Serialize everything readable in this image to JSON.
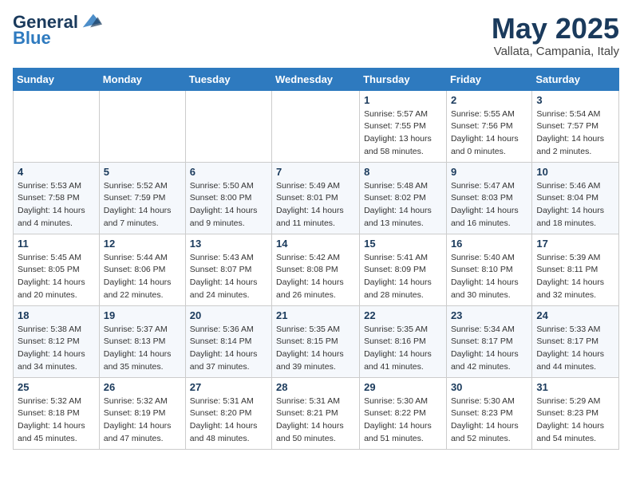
{
  "header": {
    "logo_line1": "General",
    "logo_line2": "Blue",
    "month": "May 2025",
    "location": "Vallata, Campania, Italy"
  },
  "days_of_week": [
    "Sunday",
    "Monday",
    "Tuesday",
    "Wednesday",
    "Thursday",
    "Friday",
    "Saturday"
  ],
  "weeks": [
    [
      {
        "day": "",
        "info": ""
      },
      {
        "day": "",
        "info": ""
      },
      {
        "day": "",
        "info": ""
      },
      {
        "day": "",
        "info": ""
      },
      {
        "day": "1",
        "info": "Sunrise: 5:57 AM\nSunset: 7:55 PM\nDaylight: 13 hours\nand 58 minutes."
      },
      {
        "day": "2",
        "info": "Sunrise: 5:55 AM\nSunset: 7:56 PM\nDaylight: 14 hours\nand 0 minutes."
      },
      {
        "day": "3",
        "info": "Sunrise: 5:54 AM\nSunset: 7:57 PM\nDaylight: 14 hours\nand 2 minutes."
      }
    ],
    [
      {
        "day": "4",
        "info": "Sunrise: 5:53 AM\nSunset: 7:58 PM\nDaylight: 14 hours\nand 4 minutes."
      },
      {
        "day": "5",
        "info": "Sunrise: 5:52 AM\nSunset: 7:59 PM\nDaylight: 14 hours\nand 7 minutes."
      },
      {
        "day": "6",
        "info": "Sunrise: 5:50 AM\nSunset: 8:00 PM\nDaylight: 14 hours\nand 9 minutes."
      },
      {
        "day": "7",
        "info": "Sunrise: 5:49 AM\nSunset: 8:01 PM\nDaylight: 14 hours\nand 11 minutes."
      },
      {
        "day": "8",
        "info": "Sunrise: 5:48 AM\nSunset: 8:02 PM\nDaylight: 14 hours\nand 13 minutes."
      },
      {
        "day": "9",
        "info": "Sunrise: 5:47 AM\nSunset: 8:03 PM\nDaylight: 14 hours\nand 16 minutes."
      },
      {
        "day": "10",
        "info": "Sunrise: 5:46 AM\nSunset: 8:04 PM\nDaylight: 14 hours\nand 18 minutes."
      }
    ],
    [
      {
        "day": "11",
        "info": "Sunrise: 5:45 AM\nSunset: 8:05 PM\nDaylight: 14 hours\nand 20 minutes."
      },
      {
        "day": "12",
        "info": "Sunrise: 5:44 AM\nSunset: 8:06 PM\nDaylight: 14 hours\nand 22 minutes."
      },
      {
        "day": "13",
        "info": "Sunrise: 5:43 AM\nSunset: 8:07 PM\nDaylight: 14 hours\nand 24 minutes."
      },
      {
        "day": "14",
        "info": "Sunrise: 5:42 AM\nSunset: 8:08 PM\nDaylight: 14 hours\nand 26 minutes."
      },
      {
        "day": "15",
        "info": "Sunrise: 5:41 AM\nSunset: 8:09 PM\nDaylight: 14 hours\nand 28 minutes."
      },
      {
        "day": "16",
        "info": "Sunrise: 5:40 AM\nSunset: 8:10 PM\nDaylight: 14 hours\nand 30 minutes."
      },
      {
        "day": "17",
        "info": "Sunrise: 5:39 AM\nSunset: 8:11 PM\nDaylight: 14 hours\nand 32 minutes."
      }
    ],
    [
      {
        "day": "18",
        "info": "Sunrise: 5:38 AM\nSunset: 8:12 PM\nDaylight: 14 hours\nand 34 minutes."
      },
      {
        "day": "19",
        "info": "Sunrise: 5:37 AM\nSunset: 8:13 PM\nDaylight: 14 hours\nand 35 minutes."
      },
      {
        "day": "20",
        "info": "Sunrise: 5:36 AM\nSunset: 8:14 PM\nDaylight: 14 hours\nand 37 minutes."
      },
      {
        "day": "21",
        "info": "Sunrise: 5:35 AM\nSunset: 8:15 PM\nDaylight: 14 hours\nand 39 minutes."
      },
      {
        "day": "22",
        "info": "Sunrise: 5:35 AM\nSunset: 8:16 PM\nDaylight: 14 hours\nand 41 minutes."
      },
      {
        "day": "23",
        "info": "Sunrise: 5:34 AM\nSunset: 8:17 PM\nDaylight: 14 hours\nand 42 minutes."
      },
      {
        "day": "24",
        "info": "Sunrise: 5:33 AM\nSunset: 8:17 PM\nDaylight: 14 hours\nand 44 minutes."
      }
    ],
    [
      {
        "day": "25",
        "info": "Sunrise: 5:32 AM\nSunset: 8:18 PM\nDaylight: 14 hours\nand 45 minutes."
      },
      {
        "day": "26",
        "info": "Sunrise: 5:32 AM\nSunset: 8:19 PM\nDaylight: 14 hours\nand 47 minutes."
      },
      {
        "day": "27",
        "info": "Sunrise: 5:31 AM\nSunset: 8:20 PM\nDaylight: 14 hours\nand 48 minutes."
      },
      {
        "day": "28",
        "info": "Sunrise: 5:31 AM\nSunset: 8:21 PM\nDaylight: 14 hours\nand 50 minutes."
      },
      {
        "day": "29",
        "info": "Sunrise: 5:30 AM\nSunset: 8:22 PM\nDaylight: 14 hours\nand 51 minutes."
      },
      {
        "day": "30",
        "info": "Sunrise: 5:30 AM\nSunset: 8:23 PM\nDaylight: 14 hours\nand 52 minutes."
      },
      {
        "day": "31",
        "info": "Sunrise: 5:29 AM\nSunset: 8:23 PM\nDaylight: 14 hours\nand 54 minutes."
      }
    ]
  ]
}
